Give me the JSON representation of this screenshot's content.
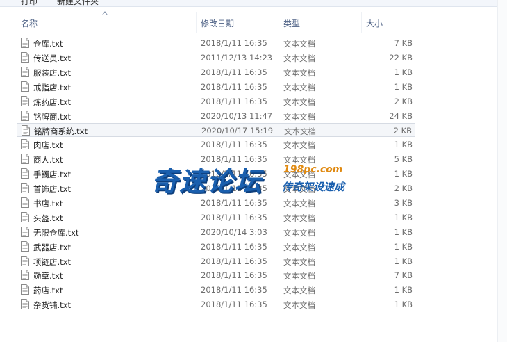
{
  "toolbar": {
    "print_label": "打印",
    "new_folder_label": "新建文件夹"
  },
  "columns": {
    "name": "名称",
    "date": "修改日期",
    "type": "类型",
    "size": "大小"
  },
  "files": [
    {
      "name": "仓库.txt",
      "date": "2018/1/11 16:35",
      "type": "文本文档",
      "size": "7 KB"
    },
    {
      "name": "传送员.txt",
      "date": "2011/12/13 14:23",
      "type": "文本文档",
      "size": "22 KB"
    },
    {
      "name": "服装店.txt",
      "date": "2018/1/11 16:35",
      "type": "文本文档",
      "size": "1 KB"
    },
    {
      "name": "戒指店.txt",
      "date": "2018/1/11 16:35",
      "type": "文本文档",
      "size": "1 KB"
    },
    {
      "name": "炼药店.txt",
      "date": "2018/1/11 16:35",
      "type": "文本文档",
      "size": "2 KB"
    },
    {
      "name": "铭牌商.txt",
      "date": "2020/10/13 11:47",
      "type": "文本文档",
      "size": "24 KB"
    },
    {
      "name": "铭牌商系统.txt",
      "date": "2020/10/17 15:19",
      "type": "文本文档",
      "size": "2 KB"
    },
    {
      "name": "肉店.txt",
      "date": "2018/1/11 16:35",
      "type": "文本文档",
      "size": "1 KB"
    },
    {
      "name": "商人.txt",
      "date": "2018/1/11 16:35",
      "type": "文本文档",
      "size": "5 KB"
    },
    {
      "name": "手镯店.txt",
      "date": "2018/1/11 16:35",
      "type": "文本文档",
      "size": "1 KB"
    },
    {
      "name": "首饰店.txt",
      "date": "2018/1/11 16:35",
      "type": "文本文档",
      "size": "2 KB"
    },
    {
      "name": "书店.txt",
      "date": "2018/1/11 16:35",
      "type": "文本文档",
      "size": "3 KB"
    },
    {
      "name": "头盔.txt",
      "date": "2018/1/11 16:35",
      "type": "文本文档",
      "size": "1 KB"
    },
    {
      "name": "无限仓库.txt",
      "date": "2020/10/14 3:03",
      "type": "文本文档",
      "size": "1 KB"
    },
    {
      "name": "武器店.txt",
      "date": "2018/1/11 16:35",
      "type": "文本文档",
      "size": "1 KB"
    },
    {
      "name": "项链店.txt",
      "date": "2018/1/11 16:35",
      "type": "文本文档",
      "size": "1 KB"
    },
    {
      "name": "勋章.txt",
      "date": "2018/1/11 16:35",
      "type": "文本文档",
      "size": "7 KB"
    },
    {
      "name": "药店.txt",
      "date": "2018/1/11 16:35",
      "type": "文本文档",
      "size": "1 KB"
    },
    {
      "name": "杂货铺.txt",
      "date": "2018/1/11 16:35",
      "type": "文本文档",
      "size": "1 KB"
    }
  ],
  "selected_index": 6,
  "icons": {
    "file": "text-file-icon",
    "sort": "sort-ascending-icon"
  },
  "watermark": {
    "main": "奇速论坛",
    "url": "198pc.com",
    "sub": "传奇架设速成"
  },
  "colors": {
    "header_text": "#4d6185",
    "secondary_text": "#6d6d6d",
    "selection_bg": "#f4f6f9",
    "watermark_blue": "#1a5fae",
    "watermark_orange": "#e08a12"
  }
}
